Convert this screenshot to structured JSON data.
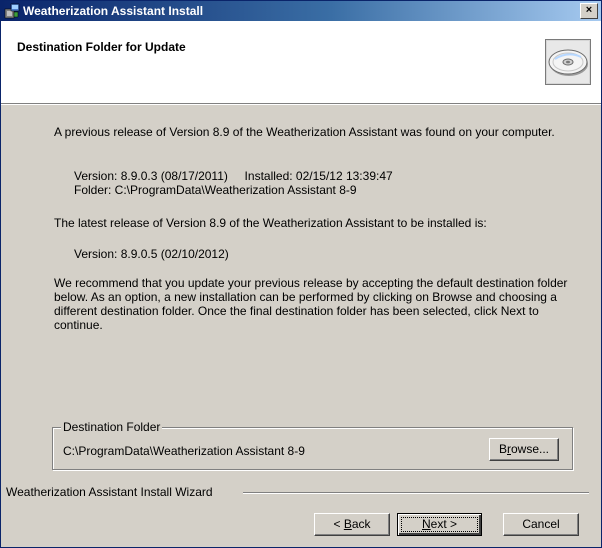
{
  "window": {
    "title": "Weatherization Assistant Install",
    "close_label": "×"
  },
  "header": {
    "title": "Destination Folder for Update",
    "icon": "cd-disc-icon"
  },
  "body": {
    "para1": "A previous release of Version 8.9 of the Weatherization Assistant was found on your computer.",
    "prev_version_line": "Version: 8.9.0.3 (08/17/2011)     Installed: 02/15/12 13:39:47",
    "prev_folder_line": "Folder: C:\\ProgramData\\Weatherization Assistant 8-9",
    "para2": "The latest release of Version 8.9 of the Weatherization Assistant to be installed is:",
    "new_version_line": "Version: 8.9.0.5 (02/10/2012)",
    "para3": "We recommend that you update your previous release by accepting the default destination folder below.  As an option, a new installation can be performed by clicking on Browse and choosing a different destination folder.  Once the final destination folder has been selected, click Next to continue."
  },
  "destination": {
    "legend": "Destination Folder",
    "path": "C:\\ProgramData\\Weatherization Assistant 8-9",
    "browse_prefix": "B",
    "browse_accel": "r",
    "browse_suffix": "owse..."
  },
  "footer": {
    "label": "Weatherization Assistant Install Wizard",
    "back_prefix": "< ",
    "back_accel": "B",
    "back_suffix": "ack",
    "next_accel": "N",
    "next_suffix": "ext >",
    "cancel_label": "Cancel"
  }
}
